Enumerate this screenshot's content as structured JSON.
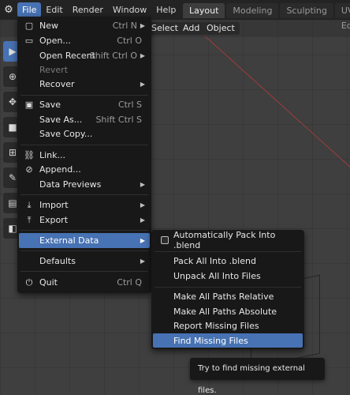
{
  "topbar": {
    "menus": [
      "File",
      "Edit",
      "Render",
      "Window",
      "Help"
    ],
    "workspace_tabs": [
      "Layout",
      "Modeling",
      "Sculpting",
      "UV Edit"
    ]
  },
  "header": {
    "select_label": "Select",
    "add_label": "Add",
    "object_label": "Object"
  },
  "file_menu": {
    "items": [
      {
        "label": "New",
        "shortcut": "Ctrl N",
        "icon": "new-file-icon",
        "submenu": true
      },
      {
        "label": "Open...",
        "shortcut": "Ctrl O",
        "icon": "folder-icon"
      },
      {
        "label": "Open Recent",
        "shortcut": "Shift Ctrl O",
        "submenu": true
      },
      {
        "label": "Revert",
        "disabled": true
      },
      {
        "label": "Recover",
        "submenu": true
      },
      {
        "label": "Save",
        "shortcut": "Ctrl S",
        "icon": "save-icon"
      },
      {
        "label": "Save As...",
        "shortcut": "Shift Ctrl S"
      },
      {
        "label": "Save Copy..."
      },
      {
        "label": "Link...",
        "icon": "link-icon"
      },
      {
        "label": "Append...",
        "icon": "append-icon"
      },
      {
        "label": "Data Previews",
        "submenu": true
      },
      {
        "label": "Import",
        "icon": "import-icon",
        "submenu": true
      },
      {
        "label": "Export",
        "icon": "export-icon",
        "submenu": true
      },
      {
        "label": "External Data",
        "submenu": true,
        "highlighted": true
      },
      {
        "label": "Defaults",
        "submenu": true
      },
      {
        "label": "Quit",
        "shortcut": "Ctrl Q",
        "icon": "power-icon"
      }
    ]
  },
  "external_data_menu": {
    "items": [
      {
        "label": "Automatically Pack Into .blend",
        "checkbox": true,
        "checked": false
      },
      {
        "label": "Pack All Into .blend"
      },
      {
        "label": "Unpack All Into Files"
      },
      {
        "label": "Make All Paths Relative"
      },
      {
        "label": "Make All Paths Absolute"
      },
      {
        "label": "Report Missing Files"
      },
      {
        "label": "Find Missing Files",
        "highlighted": true
      }
    ]
  },
  "tooltip": {
    "text": "Try to find missing external files."
  },
  "colors": {
    "accent": "#4772b3",
    "menu_bg": "#181818",
    "topbar_bg": "#232323",
    "viewport_bg": "#3f3f3f"
  }
}
